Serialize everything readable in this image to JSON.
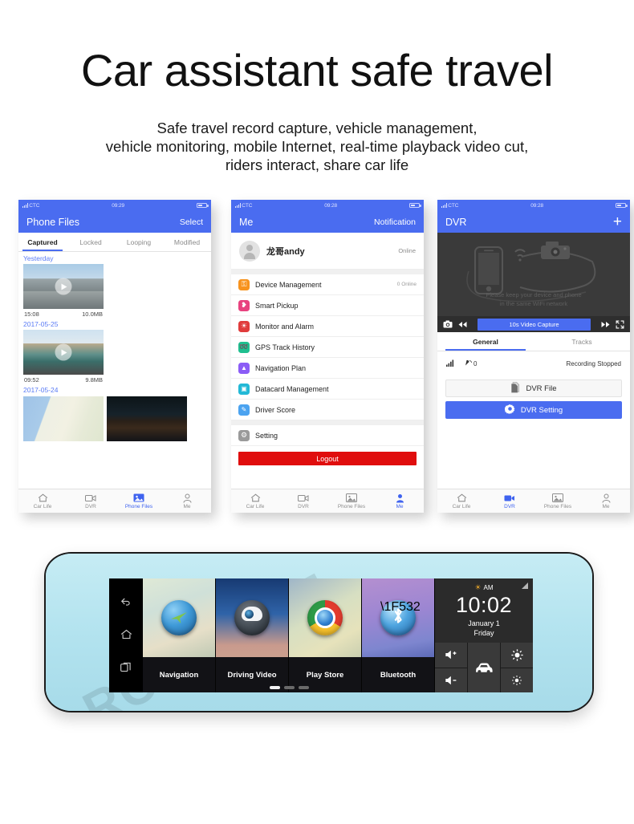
{
  "hero": {
    "title": "Car assistant safe travel",
    "subtitle_lines": [
      "Safe travel record capture, vehicle management,",
      "vehicle monitoring, mobile Internet, real-time playback video cut,",
      "riders interact, share car life"
    ]
  },
  "colors": {
    "accent_blue": "#4a6cf0",
    "logout_red": "#e00d0d",
    "mirror_body": "#b9e6f0",
    "screen_black": "#0a0a0a"
  },
  "phone1": {
    "status": {
      "carrier": "CTC",
      "time": "09:29",
      "signal_icon": "signal-bars-icon",
      "battery_icon": "battery-icon"
    },
    "navbar": {
      "title": "Phone Files",
      "action": "Select"
    },
    "tabs": [
      {
        "label": "Captured",
        "active": true
      },
      {
        "label": "Locked",
        "active": false
      },
      {
        "label": "Looping",
        "active": false
      },
      {
        "label": "Modified",
        "active": false
      }
    ],
    "groups": [
      {
        "day": "Yesterday",
        "items": [
          {
            "time": "15:08",
            "size": "10.0MB",
            "thumb": "thumb-city",
            "has_play": true
          }
        ]
      },
      {
        "day": "2017-05-25",
        "items": [
          {
            "time": "09:52",
            "size": "9.8MB",
            "thumb": "thumb-bus",
            "has_play": true
          }
        ]
      },
      {
        "day": "2017-05-24",
        "items": [
          {
            "time": "",
            "size": "",
            "thumb": "thumb-map",
            "has_play": false
          },
          {
            "time": "",
            "size": "",
            "thumb": "thumb-night",
            "has_play": true
          }
        ]
      }
    ],
    "tabbar": [
      {
        "label": "Car Life",
        "icon": "home-icon",
        "active": false
      },
      {
        "label": "DVR",
        "icon": "video-camera-icon",
        "active": false
      },
      {
        "label": "Phone Files",
        "icon": "photo-icon",
        "active": true
      },
      {
        "label": "Me",
        "icon": "person-icon",
        "active": false
      }
    ]
  },
  "phone2": {
    "status": {
      "carrier": "CTC",
      "time": "09:28",
      "signal_icon": "signal-bars-icon",
      "battery_icon": "battery-icon"
    },
    "navbar": {
      "title": "Me",
      "action": "Notification"
    },
    "profile": {
      "name": "龙哥andy",
      "status": "Online",
      "avatar_icon": "avatar-icon"
    },
    "menu": [
      {
        "label": "Device Management",
        "meta": "0 Online",
        "icon": "key-icon",
        "color": "#f7931e",
        "glyph": "⚿"
      },
      {
        "label": "Smart Pickup",
        "meta": "",
        "icon": "hands-icon",
        "color": "#e8437f",
        "glyph": "❥"
      },
      {
        "label": "Monitor and Alarm",
        "meta": "",
        "icon": "alarm-icon",
        "color": "#e03c3c",
        "glyph": "☀"
      },
      {
        "label": "GPS Track History",
        "meta": "",
        "icon": "gps-track-icon",
        "color": "#1fbf8f",
        "glyph": "➿"
      },
      {
        "label": "Navigation Plan",
        "meta": "",
        "icon": "navigation-icon",
        "color": "#8b5cf6",
        "glyph": "▲"
      },
      {
        "label": "Datacard Management",
        "meta": "",
        "icon": "datacard-icon",
        "color": "#22b8d6",
        "glyph": "▣"
      },
      {
        "label": "Driver Score",
        "meta": "",
        "icon": "score-icon",
        "color": "#4ba3f0",
        "glyph": "✎"
      },
      {
        "label": "Setting",
        "meta": "",
        "icon": "gear-icon",
        "color": "#9a9a9a",
        "glyph": "⚙"
      }
    ],
    "logout_label": "Logout",
    "tabbar": [
      {
        "label": "Car Life",
        "icon": "home-icon",
        "active": false
      },
      {
        "label": "DVR",
        "icon": "video-camera-icon",
        "active": false
      },
      {
        "label": "Phone Files",
        "icon": "photo-icon",
        "active": false
      },
      {
        "label": "Me",
        "icon": "person-icon",
        "active": true
      }
    ]
  },
  "phone3": {
    "status": {
      "carrier": "CTC",
      "time": "09:28",
      "signal_icon": "signal-bars-icon",
      "battery_icon": "battery-icon"
    },
    "navbar": {
      "title": "DVR",
      "action": "+"
    },
    "viewer": {
      "hint_line1": "Please keep your device and phone",
      "hint_line2": "in the same WiFi network",
      "controls": {
        "snapshot_icon": "camera-icon",
        "rewind_icon": "rewind-icon",
        "capture_label": "10s Video Capture",
        "forward_icon": "fast-forward-icon",
        "fullscreen_icon": "fullscreen-icon"
      }
    },
    "tabs": [
      {
        "label": "General",
        "active": true
      },
      {
        "label": "Tracks",
        "active": false
      }
    ],
    "info": {
      "signal_icon": "signal-bars-icon",
      "satellite_icon": "satellite-icon",
      "satellite_count": "0",
      "status": "Recording Stopped"
    },
    "buttons": [
      {
        "label": "DVR File",
        "icon": "file-icon",
        "style": "file"
      },
      {
        "label": "DVR Setting",
        "icon": "gear-icon",
        "style": "setting"
      }
    ],
    "tabbar": [
      {
        "label": "Car Life",
        "icon": "home-icon",
        "active": false
      },
      {
        "label": "DVR",
        "icon": "video-camera-icon",
        "active": true
      },
      {
        "label": "Phone Files",
        "icon": "photo-icon",
        "active": false
      },
      {
        "label": "Me",
        "icon": "person-icon",
        "active": false
      }
    ]
  },
  "mirror": {
    "watermark": "ROMBONE",
    "navcol": [
      {
        "icon": "back-icon",
        "glyph": "↩"
      },
      {
        "icon": "home-icon",
        "glyph": "⌂"
      },
      {
        "icon": "recents-icon",
        "glyph": "❐"
      }
    ],
    "apps": [
      {
        "label": "Navigation",
        "icon": "navigation-globe-icon"
      },
      {
        "label": "Driving Video",
        "icon": "dashcam-robot-icon"
      },
      {
        "label": "Play Store",
        "icon": "chrome-browser-icon"
      },
      {
        "label": "Bluetooth",
        "icon": "bluetooth-icon"
      }
    ],
    "page_dots": {
      "count": 3,
      "active_index": 0
    },
    "widget": {
      "ampm": "AM",
      "sun_icon": "sun-icon",
      "time": "10:02",
      "date_line1": "January 1",
      "date_line2": "Friday",
      "signal_icon": "signal-triangle-icon",
      "controls": [
        {
          "icon": "volume-up-icon",
          "glyph": "🔊+"
        },
        {
          "icon": "car-icon",
          "glyph": "🚗"
        },
        {
          "icon": "brightness-up-icon",
          "glyph": "☀"
        },
        {
          "icon": "volume-down-icon",
          "glyph": "🔊-"
        },
        {
          "icon": "brightness-down-icon",
          "glyph": "☀"
        }
      ]
    }
  }
}
